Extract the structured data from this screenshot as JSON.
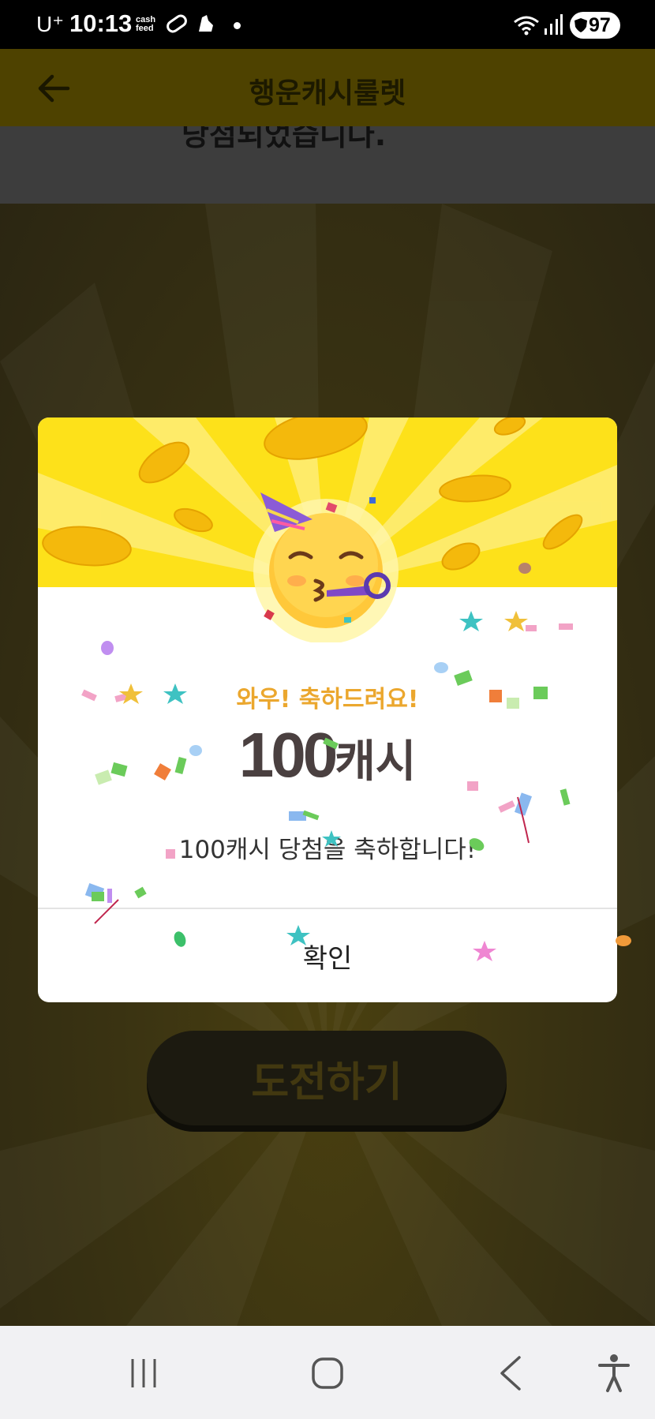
{
  "status_bar": {
    "carrier": "U⁺",
    "time": "10:13",
    "app_label_line1": "cash",
    "app_label_line2": "feed",
    "battery": "97",
    "icons": [
      "pill-icon",
      "shoe-icon",
      "notification-dot-icon",
      "wifi-icon",
      "signal-icon",
      "shield-icon"
    ]
  },
  "app": {
    "title": "행운캐시룰렛",
    "result_text": "당첨되었습니다.",
    "challenge_button": "도전하기"
  },
  "modal": {
    "emoji": "partying-face-emoji",
    "congrats": "와우! 축하드려요!",
    "amount_number": "100",
    "amount_unit": "캐시",
    "message": "100캐시 당첨을 축하합니다!",
    "confirm_label": "확인"
  },
  "colors": {
    "banner_yellow": "#fde11a",
    "congrats_orange": "#eba72e",
    "amount_text": "#4a4040"
  },
  "nav_bar": {
    "icons": [
      "recent-apps-icon",
      "home-icon",
      "back-icon",
      "accessibility-icon"
    ]
  }
}
